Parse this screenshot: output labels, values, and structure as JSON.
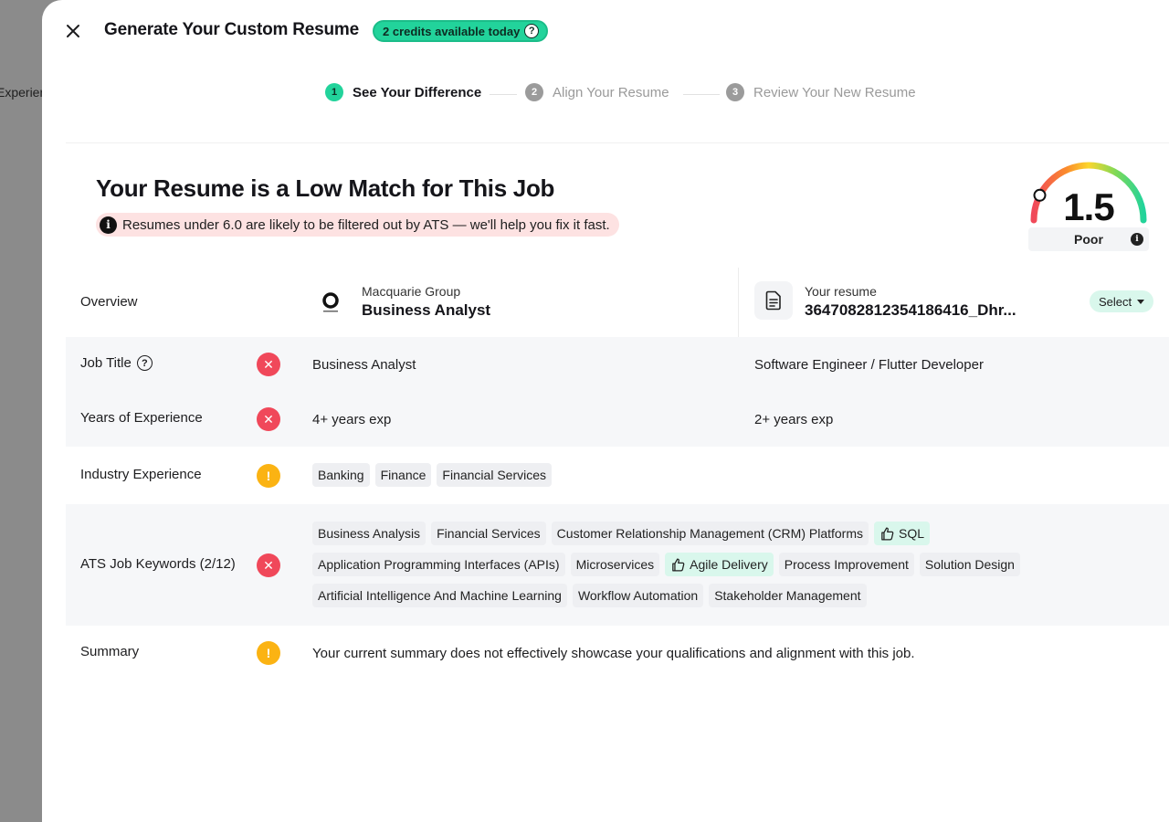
{
  "backdrop": {
    "peek_text": "Experience"
  },
  "header": {
    "title": "Generate Your Custom Resume",
    "credits_label": "2 credits available today",
    "help_glyph": "?"
  },
  "stepper": [
    {
      "number": "1",
      "label": "See Your Difference",
      "state": "active"
    },
    {
      "number": "2",
      "label": "Align Your Resume",
      "state": "inactive"
    },
    {
      "number": "3",
      "label": "Review Your New Resume",
      "state": "inactive"
    }
  ],
  "match": {
    "title": "Your Resume is a Low Match for This Job",
    "warning": "Resumes under 6.0 are likely to be filtered out by ATS — we'll help you fix it fast.",
    "score": "1.5",
    "score_label": "Poor",
    "score_max": 10
  },
  "overview": {
    "label": "Overview",
    "company": "Macquarie Group",
    "job_role": "Business Analyst",
    "resume_caption": "Your resume",
    "resume_file": "3647082812354186416_Dhr...",
    "select_label": "Select"
  },
  "rows": {
    "job_title": {
      "label": "Job Title",
      "status": "bad",
      "job": "Business Analyst",
      "resume": "Software Engineer / Flutter Developer"
    },
    "years": {
      "label": "Years of Experience",
      "status": "bad",
      "job": "4+ years exp",
      "resume": "2+ years exp"
    },
    "industry": {
      "label": "Industry Experience",
      "status": "warn",
      "tags": [
        "Banking",
        "Finance",
        "Financial Services"
      ]
    },
    "keywords": {
      "label": "ATS Job Keywords (2/12)",
      "status": "bad",
      "tags": [
        {
          "text": "Business Analysis",
          "matched": false
        },
        {
          "text": "Financial Services",
          "matched": false
        },
        {
          "text": "Customer Relationship Management (CRM) Platforms",
          "matched": false
        },
        {
          "text": "SQL",
          "matched": true
        },
        {
          "text": "Application Programming Interfaces (APIs)",
          "matched": false
        },
        {
          "text": "Microservices",
          "matched": false
        },
        {
          "text": "Agile Delivery",
          "matched": true
        },
        {
          "text": "Process Improvement",
          "matched": false
        },
        {
          "text": "Solution Design",
          "matched": false
        },
        {
          "text": "Artificial Intelligence And Machine Learning",
          "matched": false
        },
        {
          "text": "Workflow Automation",
          "matched": false
        },
        {
          "text": "Stakeholder Management",
          "matched": false
        }
      ]
    },
    "summary": {
      "label": "Summary",
      "status": "warn",
      "text": "Your current summary does not effectively showcase your qualifications and alignment with this job."
    }
  },
  "icons": {
    "close": "close-icon",
    "info": "info-icon",
    "thumbs_up": "thumbs-up-icon",
    "document": "document-icon"
  },
  "colors": {
    "accent": "#22d39b",
    "bad": "#f0485a",
    "warn": "#fbb313",
    "warning_bg": "#fde2e2",
    "matched_tag_bg": "#d9f7ec"
  }
}
